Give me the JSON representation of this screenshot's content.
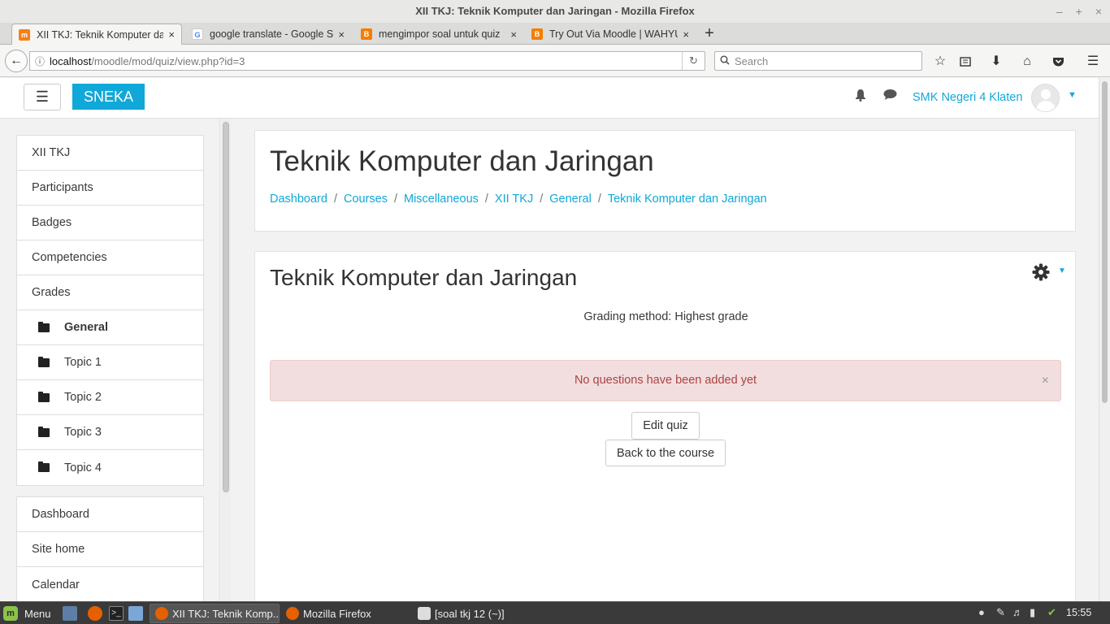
{
  "window": {
    "title": "XII TKJ: Teknik Komputer dan Jaringan - Mozilla Firefox",
    "controls": [
      "–",
      "+",
      "×"
    ]
  },
  "tabs": [
    {
      "label": "XII TKJ: Teknik Komputer dan Jaringan",
      "favicon": "m",
      "active": true
    },
    {
      "label": "google translate - Google Search",
      "favicon": "G",
      "active": false
    },
    {
      "label": "mengimpor soal untuk quiz",
      "favicon": "B",
      "active": false
    },
    {
      "label": "Try Out Via Moodle | WAHYU",
      "favicon": "B",
      "active": false
    }
  ],
  "tab_close": "×",
  "new_tab": "+",
  "nav": {
    "url_host": "localhost",
    "url_path": "/moodle/mod/quiz/view.php?id=3",
    "search_placeholder": "Search"
  },
  "site": {
    "brand": "SNEKA",
    "user_name": "SMK Negeri 4 Klaten"
  },
  "drawer": {
    "course_items": [
      {
        "label": "XII TKJ",
        "icon": "",
        "bold": false
      },
      {
        "label": "Participants",
        "icon": "",
        "bold": false
      },
      {
        "label": "Badges",
        "icon": "",
        "bold": false
      },
      {
        "label": "Competencies",
        "icon": "",
        "bold": false
      },
      {
        "label": "Grades",
        "icon": "",
        "bold": false
      },
      {
        "label": "General",
        "icon": "folder-icon",
        "bold": true
      },
      {
        "label": "Topic 1",
        "icon": "folder-icon",
        "bold": false
      },
      {
        "label": "Topic 2",
        "icon": "folder-icon",
        "bold": false
      },
      {
        "label": "Topic 3",
        "icon": "folder-icon",
        "bold": false
      },
      {
        "label": "Topic 4",
        "icon": "folder-icon",
        "bold": false
      }
    ],
    "site_items": [
      {
        "label": "Dashboard"
      },
      {
        "label": "Site home"
      },
      {
        "label": "Calendar"
      }
    ]
  },
  "header_card": {
    "heading": "Teknik Komputer dan Jaringan",
    "breadcrumb": [
      "Dashboard",
      "Courses",
      "Miscellaneous",
      "XII TKJ",
      "General",
      "Teknik Komputer dan Jaringan"
    ],
    "separator": "/"
  },
  "quiz": {
    "title": "Teknik Komputer dan Jaringan",
    "grading_method": "Grading method: Highest grade",
    "alert": "No questions have been added yet",
    "alert_close": "×",
    "edit_button": "Edit quiz",
    "back_button": "Back to the course"
  },
  "taskbar": {
    "menu_label": "Menu",
    "tasks": [
      {
        "label": "XII TKJ: Teknik Komp...",
        "active": true
      },
      {
        "label": "Mozilla Firefox",
        "active": false
      },
      {
        "label": "[soal tkj 12 (~)]",
        "active": false
      }
    ],
    "clock": "15:55"
  },
  "colors": {
    "accent": "#10a8d8",
    "alert_bg": "#f2dede",
    "alert_text": "#a94442"
  }
}
